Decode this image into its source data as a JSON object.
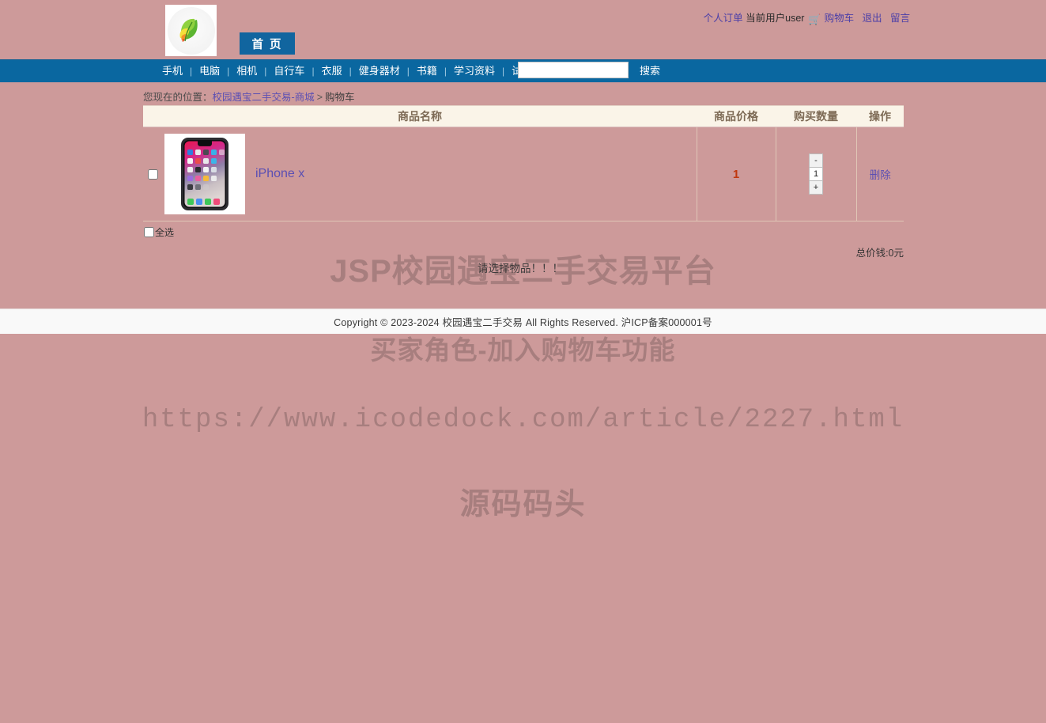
{
  "header": {
    "top_links": {
      "orders": "个人订单",
      "current_user": "当前用户user",
      "cart_icon": "shopping-cart-icon",
      "cart": "购物车",
      "logout": "退出",
      "message": "留言"
    },
    "logo_alt": "leaf-logo",
    "home_button": "首 页"
  },
  "nav": {
    "items": [
      {
        "label": "手机"
      },
      {
        "label": "电脑"
      },
      {
        "label": "相机"
      },
      {
        "label": "自行车"
      },
      {
        "label": "衣服"
      },
      {
        "label": "健身器材"
      },
      {
        "label": "书籍"
      },
      {
        "label": "学习资料"
      },
      {
        "label": "试卷"
      }
    ],
    "search_value": "",
    "search_placeholder": "",
    "search_button": "搜索"
  },
  "breadcrumb": {
    "prefix": "您现在的位置：",
    "link": "校园遇宝二手交易-商城",
    "separator": ">",
    "current": "购物车"
  },
  "cart": {
    "columns": {
      "name": "商品名称",
      "price": "商品价格",
      "quantity": "购买数量",
      "action": "操作"
    },
    "rows": [
      {
        "selected": false,
        "image_alt": "iphone-x-product-image",
        "name": "iPhone x",
        "price": "1",
        "qty_minus": "-",
        "qty_value": "1",
        "qty_plus": "+",
        "delete": "删除"
      }
    ],
    "select_all": "全选",
    "total_label": "总价钱:0元",
    "submit_button": "请选择物品！！！"
  },
  "watermarks": {
    "line1": "JSP校园遇宝二手交易平台",
    "line2": "买家角色-加入购物车功能",
    "line3": "https://www.icodedock.com/article/2227.html",
    "line4": "源码码头"
  },
  "footer": {
    "text": "Copyright © 2023-2024 校园遇宝二手交易 All Rights Reserved. 沪ICP备案000001号"
  },
  "colors": {
    "page_background": "#cd9a9a",
    "navbar": "#0a67a0",
    "home_button": "#11659f",
    "table_header_bg": "#faf4e8",
    "table_header_text": "#7d6a55",
    "link": "#5b4fb3",
    "price": "#c0380f",
    "footer_bg": "#f9f9f9"
  }
}
